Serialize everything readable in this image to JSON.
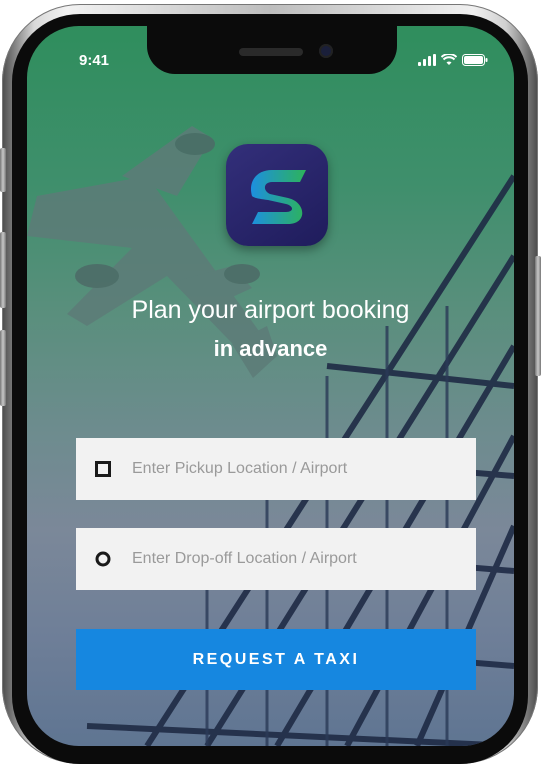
{
  "status_bar": {
    "time": "9:41"
  },
  "brand": {
    "logo_icon": "s-logo-icon",
    "accent": "#1687e0"
  },
  "tagline": {
    "line1": "Plan your airport booking",
    "line2": "in advance"
  },
  "form": {
    "pickup": {
      "placeholder": "Enter Pickup Location / Airport",
      "value": "",
      "icon": "square-marker-icon"
    },
    "dropoff": {
      "placeholder": "Enter Drop-off Location / Airport",
      "value": "",
      "icon": "circle-marker-icon"
    },
    "submit_label": "REQUEST A TAXI"
  }
}
